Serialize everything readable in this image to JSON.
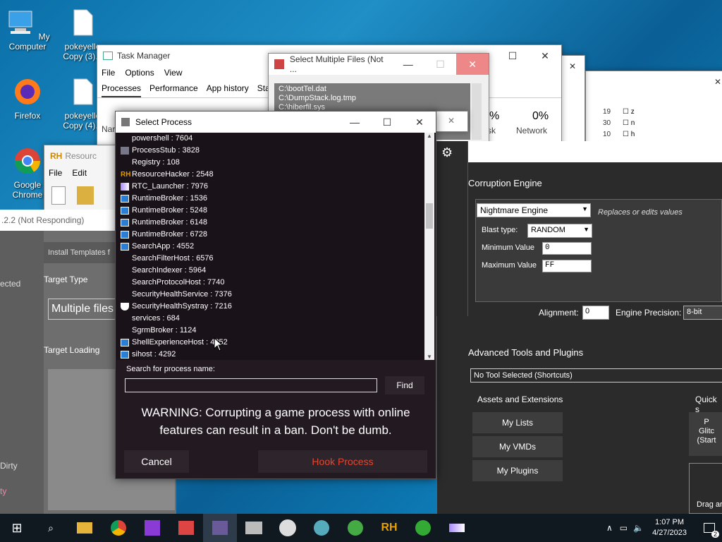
{
  "desktop": {
    "icons": [
      "My Computer",
      "pokeyello Copy (3).c",
      "Firefox",
      "pokeyello Copy (4).c",
      "Google Chrome"
    ]
  },
  "task_manager": {
    "title": "Task Manager",
    "menu": [
      "File",
      "Options",
      "View"
    ],
    "tabs": [
      "Processes",
      "Performance",
      "App history",
      "Star"
    ],
    "perf_label_1": "%",
    "perf_sub_1": "sk",
    "network_pct": "0%",
    "network_label": "Network",
    "col_label": "Nar"
  },
  "select_files": {
    "title": "Select Multiple Files (Not ...",
    "files": [
      "C:\\bootTel.dat",
      "C:\\DumpStack.log.tmp",
      "C:\\hiberfil.sys"
    ]
  },
  "resource_hacker": {
    "title": "Resourc",
    "menu": [
      "File",
      "Edit"
    ]
  },
  "rtc_left": {
    "title": ".2.2 (Not Responding)",
    "install_templates": "Install Templates f",
    "selected": "ected",
    "target_type": "Target Type",
    "target_value": "Multiple files",
    "target_loading": "Target Loading",
    "dirty": "Dirty",
    "ty": "ty"
  },
  "rtc_main": {
    "corruption_engine": "Corruption Engine",
    "engine": "Nightmare Engine",
    "engine_desc": "Replaces or edits values",
    "blast_type_label": "Blast type:",
    "blast_type": "RANDOM",
    "min_label": "Minimum Value",
    "min_value": "0",
    "max_label": "Maximum Value",
    "max_value": "FF",
    "alignment_label": "Alignment:",
    "alignment_value": "0",
    "precision_label": "Engine Precision:",
    "precision_value": "8-bit",
    "advanced_tools": "Advanced Tools and Plugins",
    "tool_select": "No Tool Selected (Shortcuts)",
    "assets": "Assets and Extensions",
    "quick": "Quick s",
    "my_lists": "My Lists",
    "my_vmds": "My VMDs",
    "my_plugins": "My Plugins",
    "glitch_1": "P",
    "glitch_2": "Glitc",
    "glitch_3": "(Start",
    "drag": "Drag ar"
  },
  "select_process": {
    "title": "Select Process",
    "processes": [
      "powershell : 7604",
      "ProcessStub : 3828",
      "Registry : 108",
      "ResourceHacker : 2548",
      "RTC_Launcher : 7976",
      "RuntimeBroker : 1536",
      "RuntimeBroker : 5248",
      "RuntimeBroker : 6148",
      "RuntimeBroker : 6728",
      "SearchApp : 4552",
      "SearchFilterHost : 6576",
      "SearchIndexer : 5964",
      "SearchProtocolHost : 7740",
      "SecurityHealthService : 7376",
      "SecurityHealthSystray : 7216",
      "services : 684",
      "SgrmBroker : 1124",
      "ShellExperienceHost : 4252",
      "sihost : 4292"
    ],
    "search_label": "Search for process name:",
    "search_value": "",
    "find": "Find",
    "warning": "WARNING: Corrupting a game process with online features can result in a ban.  Don't be dumb.",
    "cancel": "Cancel",
    "hook": "Hook Process"
  },
  "taskbar": {
    "time": "1:07 PM",
    "date": "4/27/2023",
    "notif_count": "2"
  },
  "colors": {
    "hook_text": "#e8452c",
    "dialog_bg": "#221a20",
    "rtc_bg": "#2b2b2b"
  }
}
